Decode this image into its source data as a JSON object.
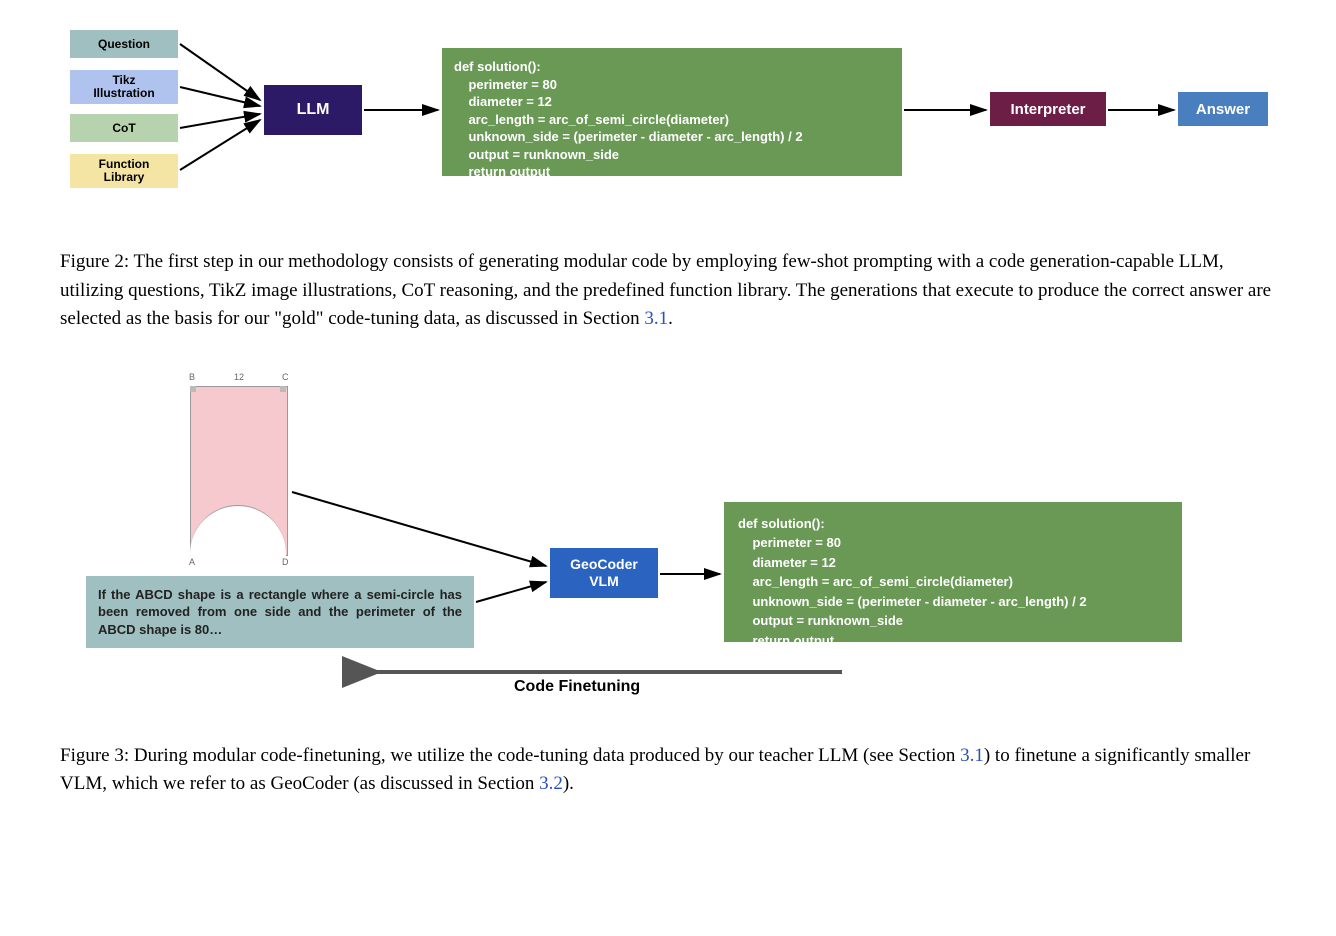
{
  "fig2": {
    "inputs": {
      "question": "Question",
      "tikz": "Tikz\nIllustration",
      "cot": "CoT",
      "funclib": "Function\nLibrary"
    },
    "llm": "LLM",
    "code": "def solution():\n    perimeter = 80\n    diameter = 12\n    arc_length = arc_of_semi_circle(diameter)\n    unknown_side = (perimeter - diameter - arc_length) / 2\n    output = runknown_side\n    return output",
    "interpreter": "Interpreter",
    "answer": "Answer",
    "caption_pre": "Figure 2: The first step in our methodology consists of generating modular code by employing few-shot prompting with a code generation-capable LLM, utilizing questions, TikZ image illustrations, CoT reasoning, and the predefined function library. The generations that execute to produce the correct answer are selected as the basis for our \"gold\" code-tuning data, as discussed in Section ",
    "caption_link": "3.1",
    "caption_post": "."
  },
  "fig3": {
    "vertices": {
      "B": "B",
      "C": "C",
      "A": "A",
      "D": "D",
      "edge": "12"
    },
    "prompt": "If the ABCD shape is a rectangle where a semi-circle has been removed from one side and the perimeter of the ABCD shape is 80…",
    "geocoder": "GeoCoder\nVLM",
    "code": "def solution():\n    perimeter = 80\n    diameter = 12\n    arc_length = arc_of_semi_circle(diameter)\n    unknown_side = (perimeter - diameter - arc_length) / 2\n    output = runknown_side\n    return output",
    "finetune_label": "Code Finetuning",
    "caption_pre": "Figure 3: During modular code-finetuning, we utilize the code-tuning data produced by our teacher LLM (see Section ",
    "caption_link1": "3.1",
    "caption_mid": ") to finetune a significantly smaller VLM, which we refer to as GeoCoder (as discussed in Section ",
    "caption_link2": "3.2",
    "caption_post": ")."
  }
}
